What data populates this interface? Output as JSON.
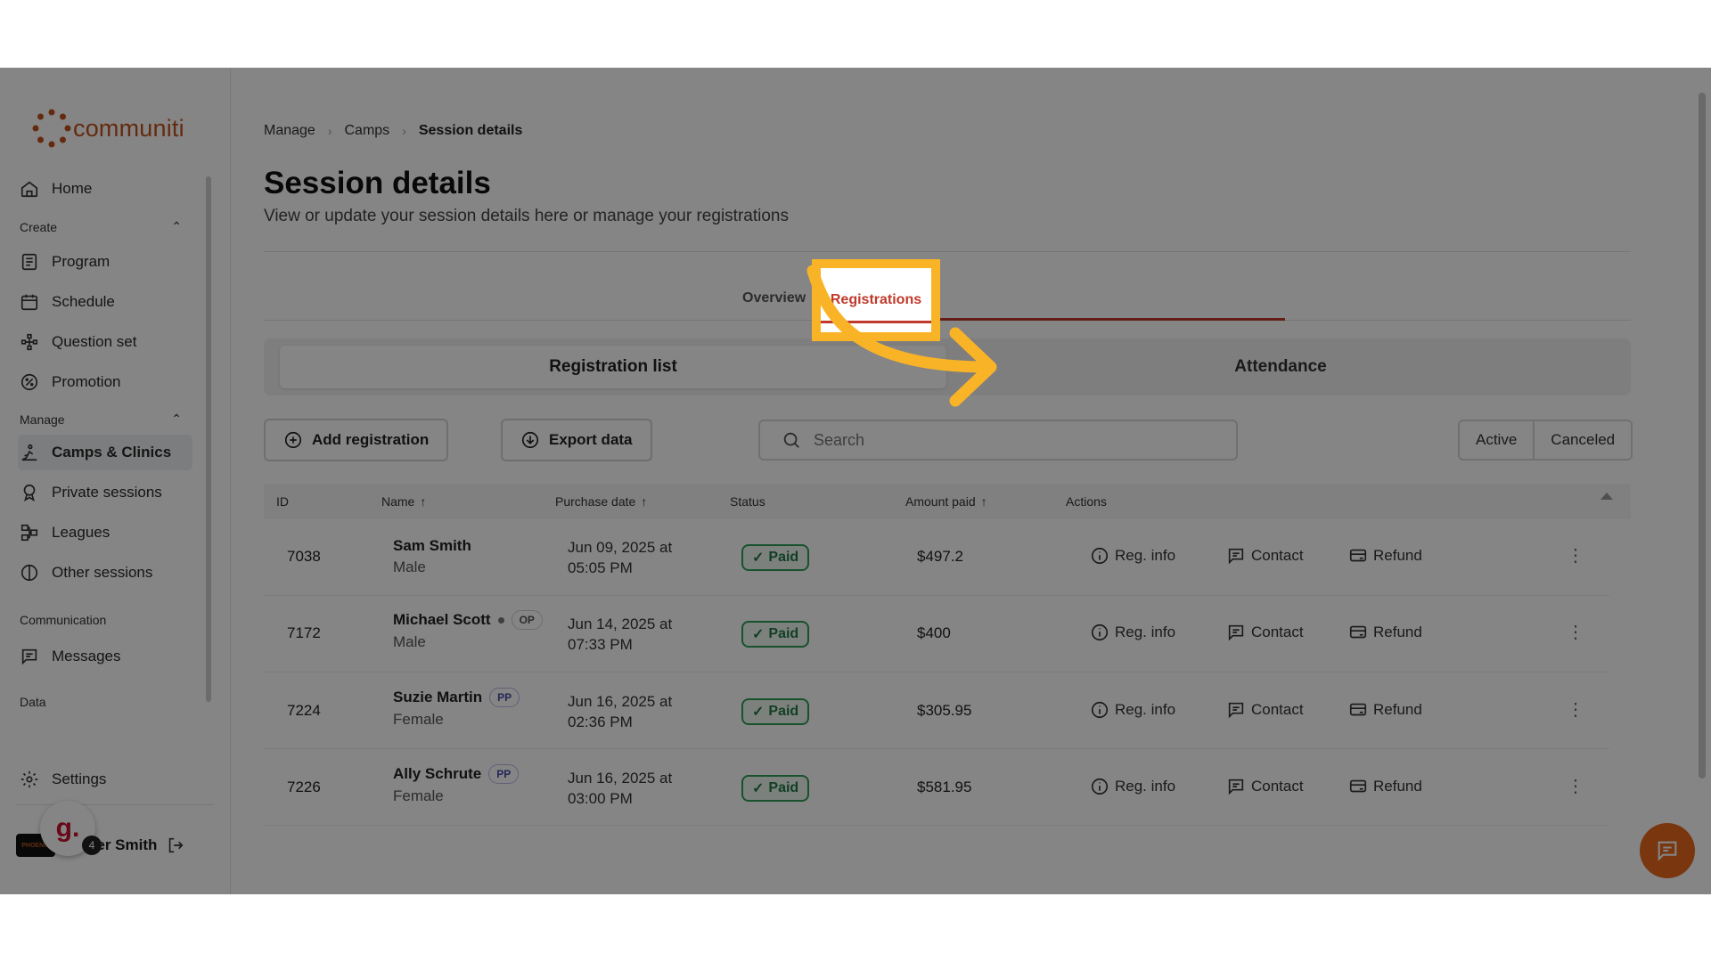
{
  "sidebar": {
    "logo_text": "communiti",
    "items_top": [
      {
        "label": "Home",
        "icon": "home-icon"
      }
    ],
    "create_label": "Create",
    "create_items": [
      {
        "label": "Program",
        "icon": "program-icon"
      },
      {
        "label": "Schedule",
        "icon": "schedule-icon"
      },
      {
        "label": "Question set",
        "icon": "question-set-icon"
      },
      {
        "label": "Promotion",
        "icon": "promotion-icon"
      }
    ],
    "manage_label": "Manage",
    "manage_items": [
      {
        "label": "Camps & Clinics",
        "icon": "camps-icon"
      },
      {
        "label": "Private sessions",
        "icon": "private-sessions-icon"
      },
      {
        "label": "Leagues",
        "icon": "leagues-icon"
      },
      {
        "label": "Other sessions",
        "icon": "other-sessions-icon"
      }
    ],
    "communication_label": "Communication",
    "messages_label": "Messages",
    "data_label": "Data",
    "settings_label": "Settings",
    "user_name": "ger Smith",
    "user_avatar_text": "PHOENIX",
    "g_badge": "g.",
    "g_count": "4"
  },
  "breadcrumb": {
    "items": [
      "Manage",
      "Camps",
      "Session details"
    ]
  },
  "page": {
    "title": "Session details",
    "subtitle": "View or update your session details here or manage your registrations"
  },
  "tabs": {
    "overview": "Overview",
    "registrations": "Registrations"
  },
  "segments": {
    "list": "Registration list",
    "attendance": "Attendance"
  },
  "toolbar": {
    "add_label": "Add registration",
    "export_label": "Export data",
    "search_placeholder": "Search",
    "filter_active": "Active",
    "filter_canceled": "Canceled"
  },
  "table": {
    "headers": {
      "id": "ID",
      "name": "Name",
      "purchase": "Purchase date",
      "status": "Status",
      "amount": "Amount paid",
      "actions": "Actions"
    },
    "actions": {
      "info": "Reg. info",
      "contact": "Contact",
      "refund": "Refund"
    },
    "rows": [
      {
        "id": "7038",
        "name": "Sam Smith",
        "gender": "Male",
        "date1": "Jun 09, 2025 at",
        "date2": "05:05 PM",
        "status": "Paid",
        "amount": "$497.2",
        "badge": ""
      },
      {
        "id": "7172",
        "name": "Michael Scott",
        "gender": "Male",
        "date1": "Jun 14, 2025 at",
        "date2": "07:33 PM",
        "status": "Paid",
        "amount": "$400",
        "badge": "OP"
      },
      {
        "id": "7224",
        "name": "Suzie Martin",
        "gender": "Female",
        "date1": "Jun 16, 2025 at",
        "date2": "02:36 PM",
        "status": "Paid",
        "amount": "$305.95",
        "badge": "PP"
      },
      {
        "id": "7226",
        "name": "Ally Schrute",
        "gender": "Female",
        "date1": "Jun 16, 2025 at",
        "date2": "03:00 PM",
        "status": "Paid",
        "amount": "$581.95",
        "badge": "PP"
      }
    ]
  },
  "colors": {
    "brand": "#c0521b",
    "highlight": "#f9b327",
    "accent_red": "#c0392b",
    "paid_green": "#2e9d57",
    "chat": "#e8691e"
  }
}
